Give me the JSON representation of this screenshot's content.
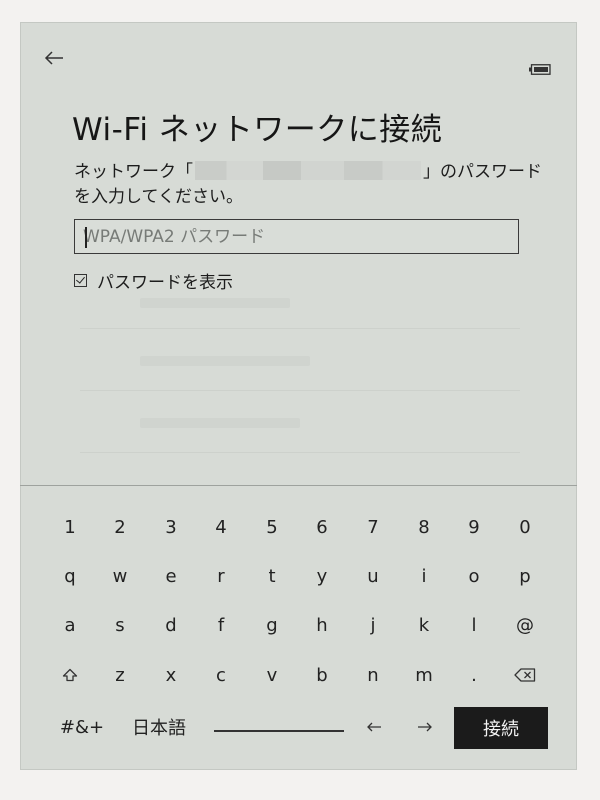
{
  "header": {
    "back_icon": "arrow-left-icon",
    "battery_icon": "battery-icon"
  },
  "title": "Wi-Fi ネットワークに接続",
  "description": {
    "prefix": "ネットワーク「",
    "suffix": "」のパスワードを入力してください。"
  },
  "password": {
    "value": "",
    "placeholder": "WPA/WPA2 パスワード"
  },
  "show_password": {
    "label": "パスワードを表示",
    "checked": true
  },
  "keyboard": {
    "row1": [
      "1",
      "2",
      "3",
      "4",
      "5",
      "6",
      "7",
      "8",
      "9",
      "0"
    ],
    "row2": [
      "q",
      "w",
      "e",
      "r",
      "t",
      "y",
      "u",
      "i",
      "o",
      "p"
    ],
    "row3": [
      "a",
      "s",
      "d",
      "f",
      "g",
      "h",
      "j",
      "k",
      "l",
      "@"
    ],
    "row4": {
      "shift_icon": "shift-icon",
      "keys": [
        "z",
        "x",
        "c",
        "v",
        "b",
        "n",
        "m",
        "."
      ],
      "backspace_icon": "backspace-icon"
    },
    "row5": {
      "symbols": "#&+",
      "language": "日本語",
      "left_icon": "arrow-left-icon",
      "right_icon": "arrow-right-icon",
      "connect": "接続"
    }
  }
}
